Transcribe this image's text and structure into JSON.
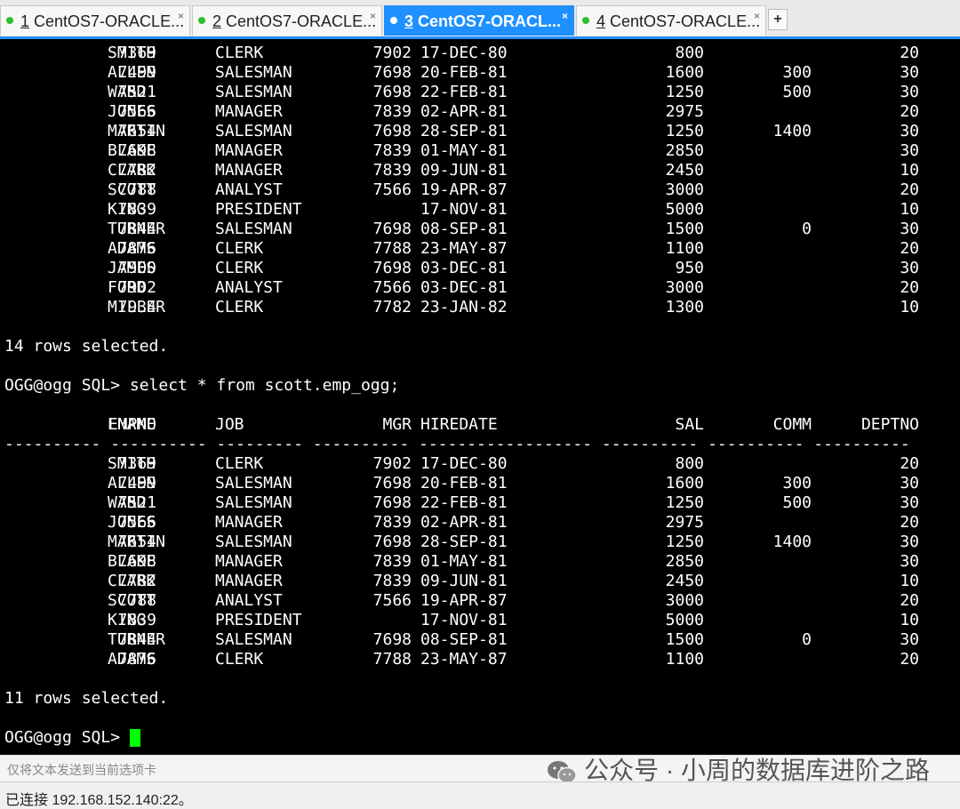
{
  "tabs": [
    {
      "num": "1",
      "label": " CentOS7-ORACLE..."
    },
    {
      "num": "2",
      "label": " CentOS7-ORACLE..."
    },
    {
      "num": "3",
      "label": " CentOS7-ORACL..."
    },
    {
      "num": "4",
      "label": " CentOS7-ORACLE..."
    }
  ],
  "plus_label": "+",
  "close_glyph": "×",
  "rows1": [
    [
      "7369",
      "SMITH",
      "CLERK",
      "7902",
      "17-DEC-80",
      "800",
      "",
      "20"
    ],
    [
      "7499",
      "ALLEN",
      "SALESMAN",
      "7698",
      "20-FEB-81",
      "1600",
      "300",
      "30"
    ],
    [
      "7521",
      "WARD",
      "SALESMAN",
      "7698",
      "22-FEB-81",
      "1250",
      "500",
      "30"
    ],
    [
      "7566",
      "JONES",
      "MANAGER",
      "7839",
      "02-APR-81",
      "2975",
      "",
      "20"
    ],
    [
      "7654",
      "MARTIN",
      "SALESMAN",
      "7698",
      "28-SEP-81",
      "1250",
      "1400",
      "30"
    ],
    [
      "7698",
      "BLAKE",
      "MANAGER",
      "7839",
      "01-MAY-81",
      "2850",
      "",
      "30"
    ],
    [
      "7782",
      "CLARK",
      "MANAGER",
      "7839",
      "09-JUN-81",
      "2450",
      "",
      "10"
    ],
    [
      "7788",
      "SCOTT",
      "ANALYST",
      "7566",
      "19-APR-87",
      "3000",
      "",
      "20"
    ],
    [
      "7839",
      "KING",
      "PRESIDENT",
      "",
      "17-NOV-81",
      "5000",
      "",
      "10"
    ],
    [
      "7844",
      "TURNER",
      "SALESMAN",
      "7698",
      "08-SEP-81",
      "1500",
      "0",
      "30"
    ],
    [
      "7876",
      "ADAMS",
      "CLERK",
      "7788",
      "23-MAY-87",
      "1100",
      "",
      "20"
    ],
    [
      "7900",
      "JAMES",
      "CLERK",
      "7698",
      "03-DEC-81",
      "950",
      "",
      "30"
    ],
    [
      "7902",
      "FORD",
      "ANALYST",
      "7566",
      "03-DEC-81",
      "3000",
      "",
      "20"
    ],
    [
      "7934",
      "MILLER",
      "CLERK",
      "7782",
      "23-JAN-82",
      "1300",
      "",
      "10"
    ]
  ],
  "rows_selected_1": "14 rows selected.",
  "prompt_command": "OGG@ogg SQL> select * from scott.emp_ogg;",
  "headers": [
    "EMPNO",
    "ENAME",
    "JOB",
    "MGR",
    "HIREDATE",
    "SAL",
    "COMM",
    "DEPTNO"
  ],
  "separator": "---------- ---------- --------- ---------- ------------------ ---------- ---------- ----------",
  "rows2": [
    [
      "7369",
      "SMITH",
      "CLERK",
      "7902",
      "17-DEC-80",
      "800",
      "",
      "20"
    ],
    [
      "7499",
      "ALLEN",
      "SALESMAN",
      "7698",
      "20-FEB-81",
      "1600",
      "300",
      "30"
    ],
    [
      "7521",
      "WARD",
      "SALESMAN",
      "7698",
      "22-FEB-81",
      "1250",
      "500",
      "30"
    ],
    [
      "7566",
      "JONES",
      "MANAGER",
      "7839",
      "02-APR-81",
      "2975",
      "",
      "20"
    ],
    [
      "7654",
      "MARTIN",
      "SALESMAN",
      "7698",
      "28-SEP-81",
      "1250",
      "1400",
      "30"
    ],
    [
      "7698",
      "BLAKE",
      "MANAGER",
      "7839",
      "01-MAY-81",
      "2850",
      "",
      "30"
    ],
    [
      "7782",
      "CLARK",
      "MANAGER",
      "7839",
      "09-JUN-81",
      "2450",
      "",
      "10"
    ],
    [
      "7788",
      "SCOTT",
      "ANALYST",
      "7566",
      "19-APR-87",
      "3000",
      "",
      "20"
    ],
    [
      "7839",
      "KING",
      "PRESIDENT",
      "",
      "17-NOV-81",
      "5000",
      "",
      "10"
    ],
    [
      "7844",
      "TURNER",
      "SALESMAN",
      "7698",
      "08-SEP-81",
      "1500",
      "0",
      "30"
    ],
    [
      "7876",
      "ADAMS",
      "CLERK",
      "7788",
      "23-MAY-87",
      "1100",
      "",
      "20"
    ]
  ],
  "rows_selected_2": "11 rows selected.",
  "final_prompt": "OGG@ogg SQL> ",
  "input_placeholder": "仅将文本发送到当前选项卡",
  "watermark": "公众号 · 小周的数据库进阶之路",
  "status": "已连接 192.168.152.140:22。",
  "colors": {
    "active_tab": "#1e90ff",
    "cursor": "#00ff00",
    "connected_dot": "#2ec12e"
  }
}
